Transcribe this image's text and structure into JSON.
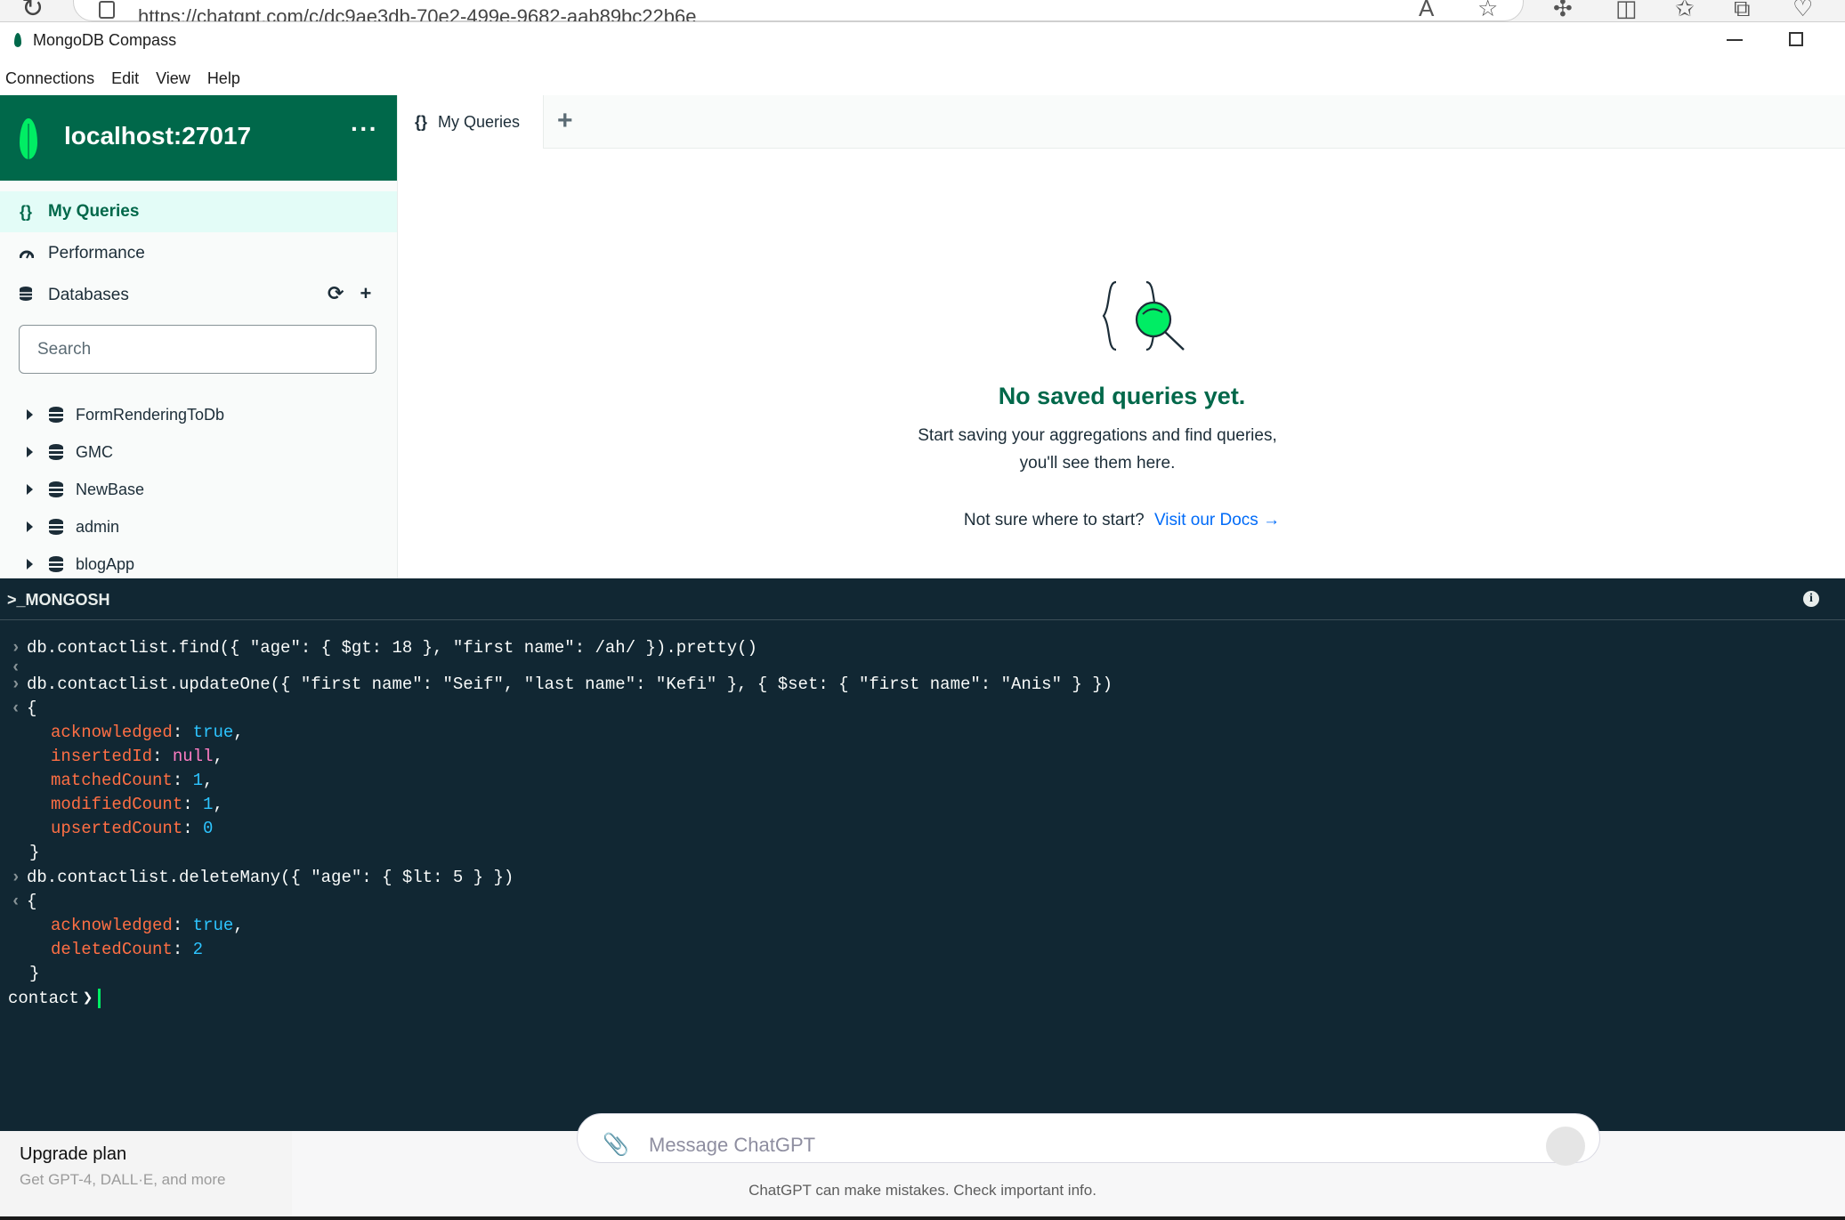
{
  "browser": {
    "url": "https://chatgpt.com/c/dc9ae3db-70e2-499e-9682-aab89bc22b6e"
  },
  "window": {
    "title": "MongoDB Compass"
  },
  "menubar": {
    "items": [
      "Connections",
      "Edit",
      "View",
      "Help"
    ]
  },
  "sidebar": {
    "connection": "localhost:27017",
    "more_label": "···",
    "nav": {
      "my_queries": "My Queries",
      "performance": "Performance",
      "databases": "Databases"
    },
    "search_placeholder": "Search",
    "databases": [
      "FormRenderingToDb",
      "GMC",
      "NewBase",
      "admin",
      "blogApp"
    ]
  },
  "tabs": {
    "active_label": "My Queries",
    "add_label": "+"
  },
  "empty_state": {
    "title": "No saved queries yet.",
    "description": "Start saving your aggregations and find queries, you'll see them here.",
    "docs_prompt": "Not sure where to start?",
    "docs_link": "Visit our Docs →"
  },
  "shell": {
    "title": ">_MONGOSH",
    "commands": {
      "find": "db.contactlist.find({ \"age\": { $gt: 18 }, \"first name\": /ah/ }).pretty()",
      "update": "db.contactlist.updateOne({ \"first name\": \"Seif\", \"last name\": \"Kefi\" }, { $set: { \"first name\": \"Anis\" } })",
      "delete": "db.contactlist.deleteMany({ \"age\": { $lt: 5 } })"
    },
    "update_result": {
      "acknowledged": "true",
      "insertedId": "null",
      "matchedCount": "1",
      "modifiedCount": "1",
      "upsertedCount": "0"
    },
    "delete_result": {
      "acknowledged": "true",
      "deletedCount": "2"
    },
    "prompt": "contact"
  },
  "chatgpt": {
    "upgrade_title": "Upgrade plan",
    "upgrade_sub": "Get GPT-4, DALL·E, and more",
    "message_placeholder": "Message ChatGPT",
    "disclaimer": "ChatGPT can make mistakes. Check important info."
  },
  "colors": {
    "brand_green": "#00684a",
    "leaf_green": "#00ed64",
    "shell_bg": "#112733",
    "key": "#ff6f44",
    "bool": "#2dc4ff",
    "null": "#ff7dc4",
    "link": "#016bf8"
  }
}
